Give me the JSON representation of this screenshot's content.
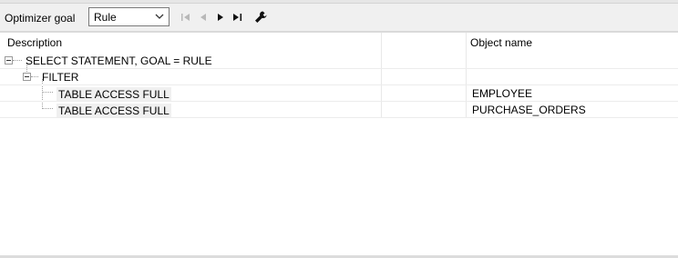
{
  "toolbar": {
    "goal_label": "Optimizer goal",
    "goal_value": "Rule",
    "icons": [
      "first-icon",
      "previous-icon",
      "next-icon",
      "last-icon",
      "wrench-icon"
    ]
  },
  "tree": {
    "columns": {
      "description": "Description",
      "object_name": "Object name"
    },
    "rows": [
      {
        "description": "SELECT STATEMENT, GOAL = RULE",
        "object_name": ""
      },
      {
        "description": "FILTER",
        "object_name": ""
      },
      {
        "description": "TABLE ACCESS FULL",
        "object_name": "EMPLOYEE"
      },
      {
        "description": "TABLE ACCESS FULL",
        "object_name": "PURCHASE_ORDERS"
      }
    ]
  }
}
